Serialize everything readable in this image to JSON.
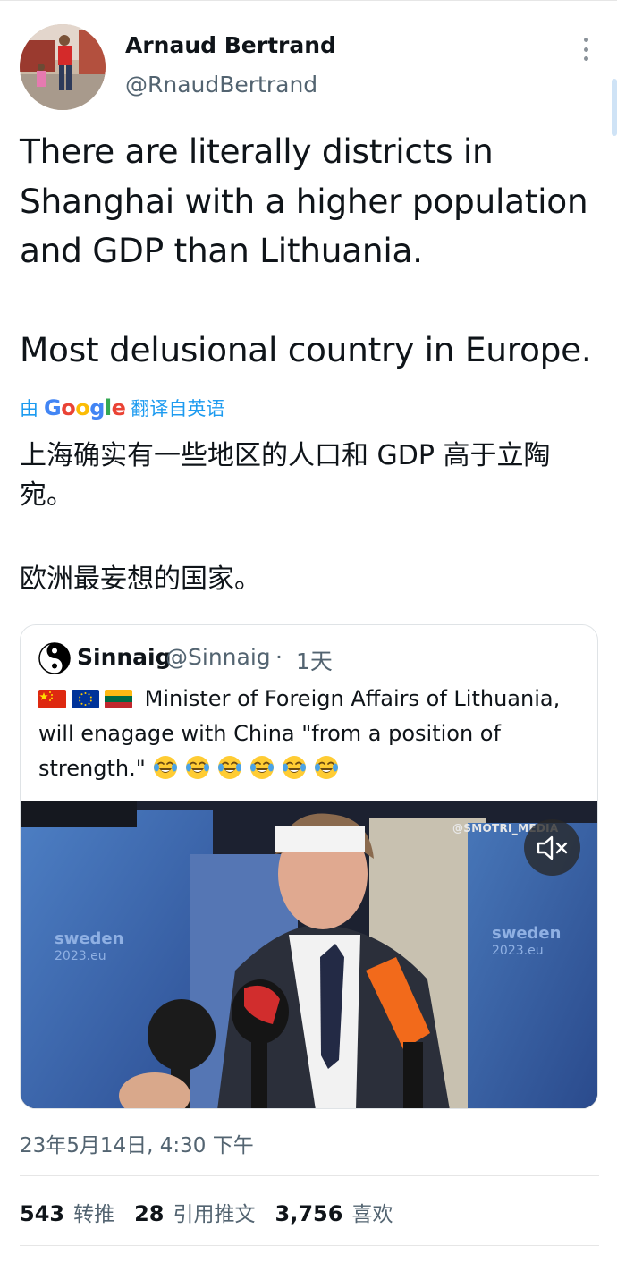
{
  "author": {
    "name": "Arnaud Bertrand",
    "handle": "@RnaudBertrand"
  },
  "tweet": {
    "paragraph_1": "There are literally districts in Shanghai with a higher population and GDP than Lithuania.",
    "paragraph_2": "Most delusional country in Europe."
  },
  "translation": {
    "prefix": "由",
    "provider": "Google",
    "suffix": "翻译自英语",
    "paragraph_1": "上海确实有一些地区的人口和 GDP 高于立陶宛。",
    "paragraph_2": "欧洲最妄想的国家。"
  },
  "quote": {
    "name": "Sinnaig",
    "handle": "@Sinnaig",
    "separator": "·",
    "time": "1天",
    "text": "Minister of Foreign Affairs of Lithuania, will enagage with China \"from a position of strength.\"",
    "flags": [
      "china-flag",
      "eu-flag",
      "lithuania-flag"
    ],
    "emoji_count": 6,
    "emoji": "face-with-tears-of-joy",
    "media": {
      "watermark": "@SMOTRI_MEDIA",
      "backdrop_text": "sweden 2023.eu",
      "mute_icon": "speaker-muted-icon"
    }
  },
  "timestamp": "23年5月14日, 4:30 下午",
  "stats": [
    {
      "count": "543",
      "label": "转推"
    },
    {
      "count": "28",
      "label": "引用推文"
    },
    {
      "count": "3,756",
      "label": "喜欢"
    }
  ],
  "colors": {
    "link": "#1d9bf0",
    "secondary_text": "#536471",
    "primary_text": "#0f1419",
    "divider": "#e6e6e6"
  }
}
